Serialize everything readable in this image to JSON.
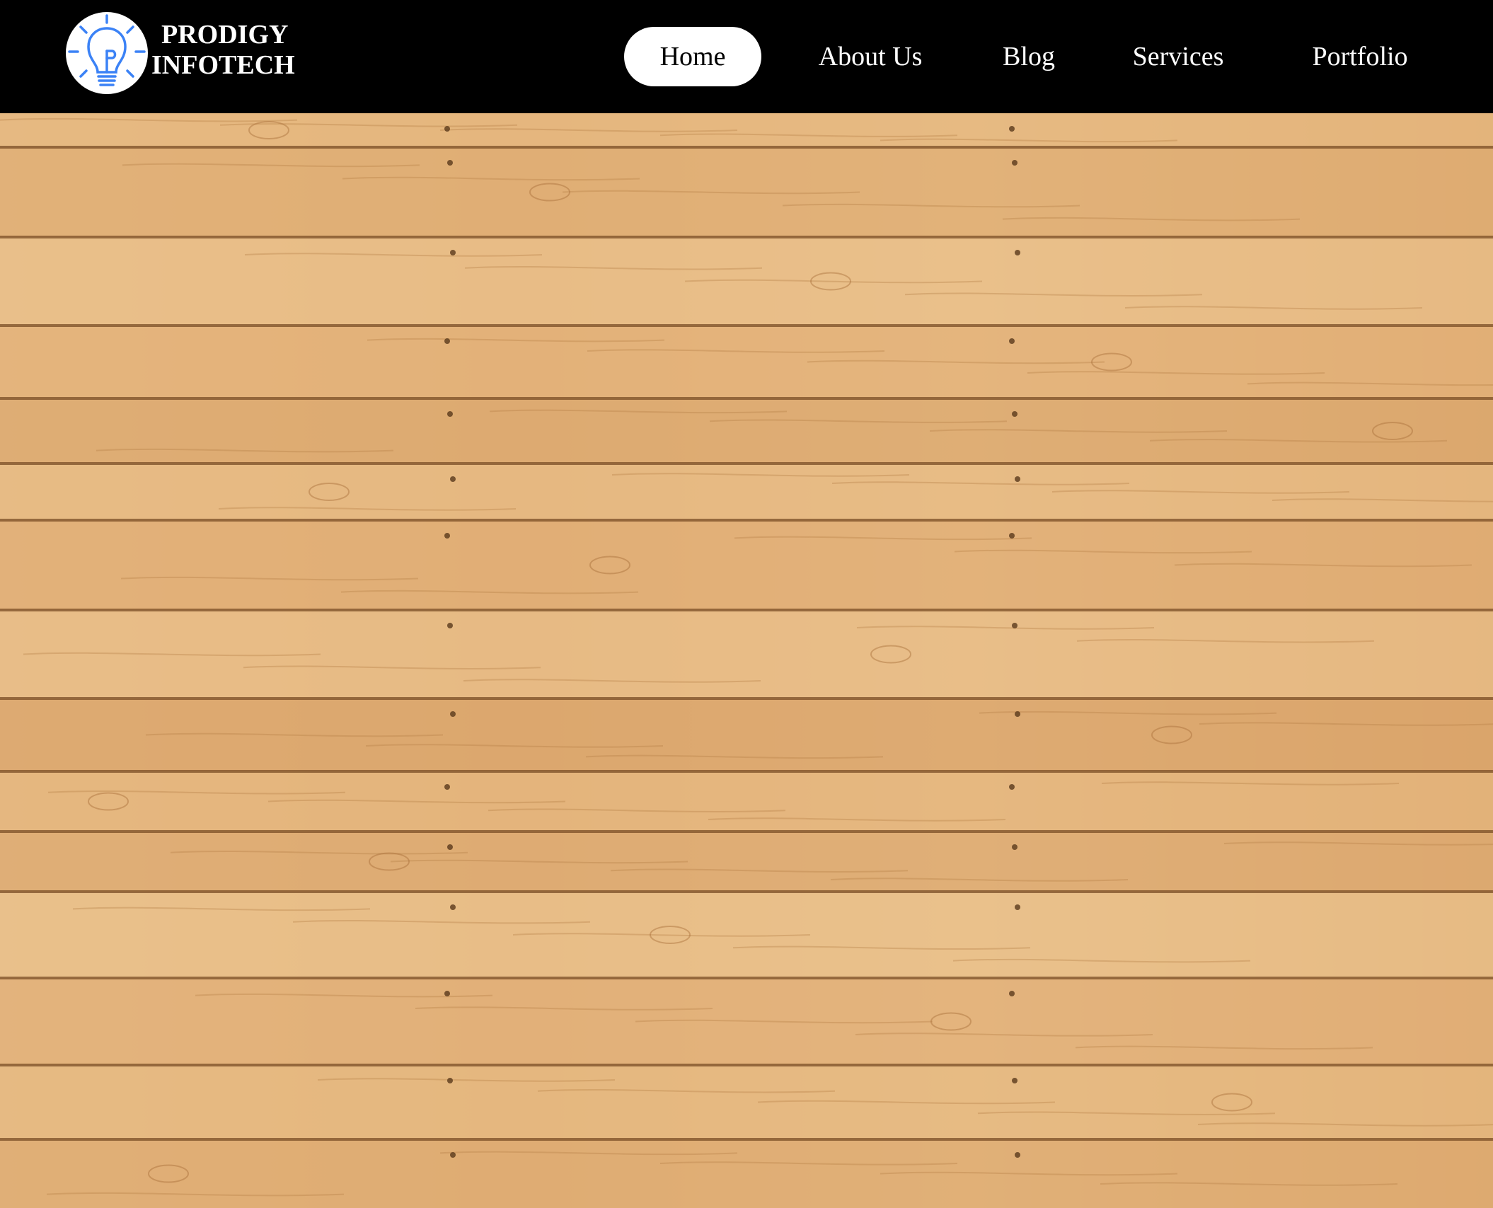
{
  "header": {
    "background": "#000000",
    "logo": {
      "line1": "PRODIGY",
      "line2": "INFOTECH",
      "badge_letter": "P",
      "icon": "lightbulb-icon",
      "accent_color": "#3b82f6"
    },
    "nav": {
      "items": [
        {
          "label": "Home",
          "active": true
        },
        {
          "label": "About Us",
          "active": false
        },
        {
          "label": "Blog",
          "active": false
        },
        {
          "label": "Services",
          "active": false
        },
        {
          "label": "Portfolio",
          "active": false
        }
      ]
    }
  },
  "hero": {
    "image": "wood-planks-background",
    "base_color": "#e4b47c",
    "seam_color": "#7a4e26"
  }
}
